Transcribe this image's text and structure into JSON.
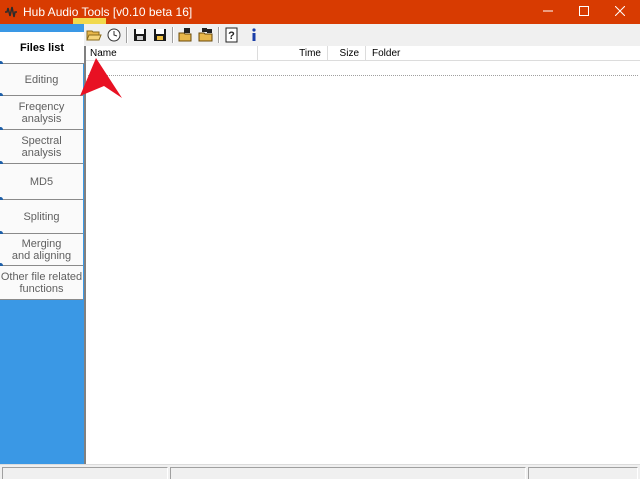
{
  "window": {
    "title": "Hub Audio Tools [v0.10 beta 16]",
    "titlebar_color": "#d83b01"
  },
  "toolbar": {
    "buttons": [
      {
        "name": "open-folder-icon",
        "highlighted": true
      },
      {
        "name": "clock-icon"
      },
      {
        "name": "save-icon"
      },
      {
        "name": "save-all-icon"
      },
      {
        "name": "open-icon"
      },
      {
        "name": "batch-open-icon"
      },
      {
        "name": "help-icon"
      },
      {
        "name": "info-icon"
      }
    ]
  },
  "sidebar": {
    "accent": "#3a98e5",
    "items": [
      {
        "label": "Files list",
        "active": true
      },
      {
        "label": "Editing"
      },
      {
        "label": "Freqency\nanalysis"
      },
      {
        "label": "Spectral\nanalysis"
      },
      {
        "label": "MD5"
      },
      {
        "label": "Spliting"
      },
      {
        "label": "Merging\nand aligning"
      },
      {
        "label": "Other file related\nfunctions"
      }
    ]
  },
  "file_list": {
    "columns": [
      "Name",
      "Time",
      "Size",
      "Folder"
    ],
    "rows": []
  },
  "annotation": {
    "color": "#e81123",
    "target": "open-folder-icon"
  }
}
